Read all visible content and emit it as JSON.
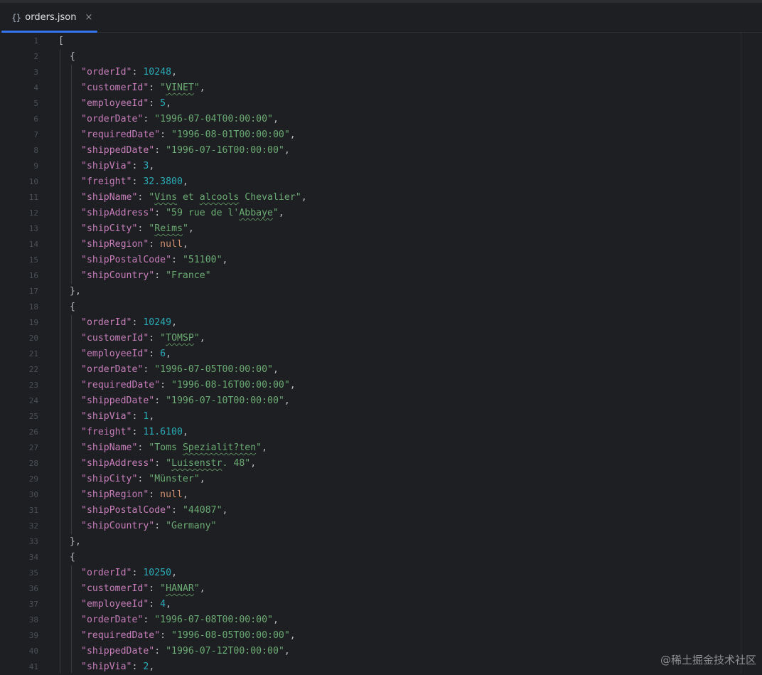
{
  "tab": {
    "icon": "{}",
    "title": "orders.json",
    "close": "×"
  },
  "watermark": "@稀土掘金技术社区",
  "orders": [
    {
      "orderId": "10248",
      "customerId": "VINET",
      "employeeId": "5",
      "orderDate": "1996-07-04T00:00:00",
      "requiredDate": "1996-08-01T00:00:00",
      "shippedDate": "1996-07-16T00:00:00",
      "shipVia": "3",
      "freight": "32.3800",
      "shipName": "Vins et alcools Chevalier",
      "shipAddress": "59 rue de l'Abbaye",
      "shipCity": "Reims",
      "shipRegion": "null",
      "shipPostalCode": "51100",
      "shipCountry": "France"
    },
    {
      "orderId": "10249",
      "customerId": "TOMSP",
      "employeeId": "6",
      "orderDate": "1996-07-05T00:00:00",
      "requiredDate": "1996-08-16T00:00:00",
      "shippedDate": "1996-07-10T00:00:00",
      "shipVia": "1",
      "freight": "11.6100",
      "shipName": "Toms Spezialit?ten",
      "shipAddress": "Luisenstr. 48",
      "shipCity": "Münster",
      "shipRegion": "null",
      "shipPostalCode": "44087",
      "shipCountry": "Germany"
    },
    {
      "orderId": "10250",
      "customerId": "HANAR",
      "employeeId": "4",
      "orderDate": "1996-07-08T00:00:00",
      "requiredDate": "1996-08-05T00:00:00",
      "shippedDate": "1996-07-12T00:00:00",
      "shipVia": "2"
    }
  ]
}
